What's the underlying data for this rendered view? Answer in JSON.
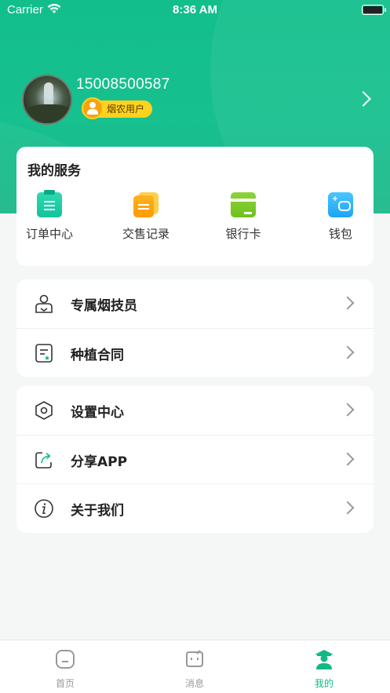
{
  "status_bar": {
    "carrier": "Carrier",
    "time": "8:36 AM"
  },
  "profile": {
    "phone": "15008500587",
    "badge": "烟农用户"
  },
  "services": {
    "title": "我的服务",
    "items": [
      {
        "label": "订单中心",
        "icon": "order-clipboard-icon"
      },
      {
        "label": "交售记录",
        "icon": "sale-record-icon"
      },
      {
        "label": "银行卡",
        "icon": "bank-card-icon"
      },
      {
        "label": "钱包",
        "icon": "wallet-icon"
      }
    ]
  },
  "menu_group_1": [
    {
      "label": "专属烟技员",
      "icon": "technician-icon"
    },
    {
      "label": "种植合同",
      "icon": "contract-icon"
    }
  ],
  "menu_group_2": [
    {
      "label": "设置中心",
      "icon": "settings-hexagon-icon"
    },
    {
      "label": "分享APP",
      "icon": "share-icon"
    },
    {
      "label": "关于我们",
      "icon": "info-icon"
    }
  ],
  "tabbar": {
    "items": [
      {
        "label": "首页",
        "icon": "home-icon",
        "active": false
      },
      {
        "label": "消息",
        "icon": "message-icon",
        "active": false
      },
      {
        "label": "我的",
        "icon": "farmer-profile-icon",
        "active": true
      }
    ]
  },
  "colors": {
    "brand": "#12bf8c",
    "badge": "#ffd21e",
    "background": "#f4f7f6"
  }
}
